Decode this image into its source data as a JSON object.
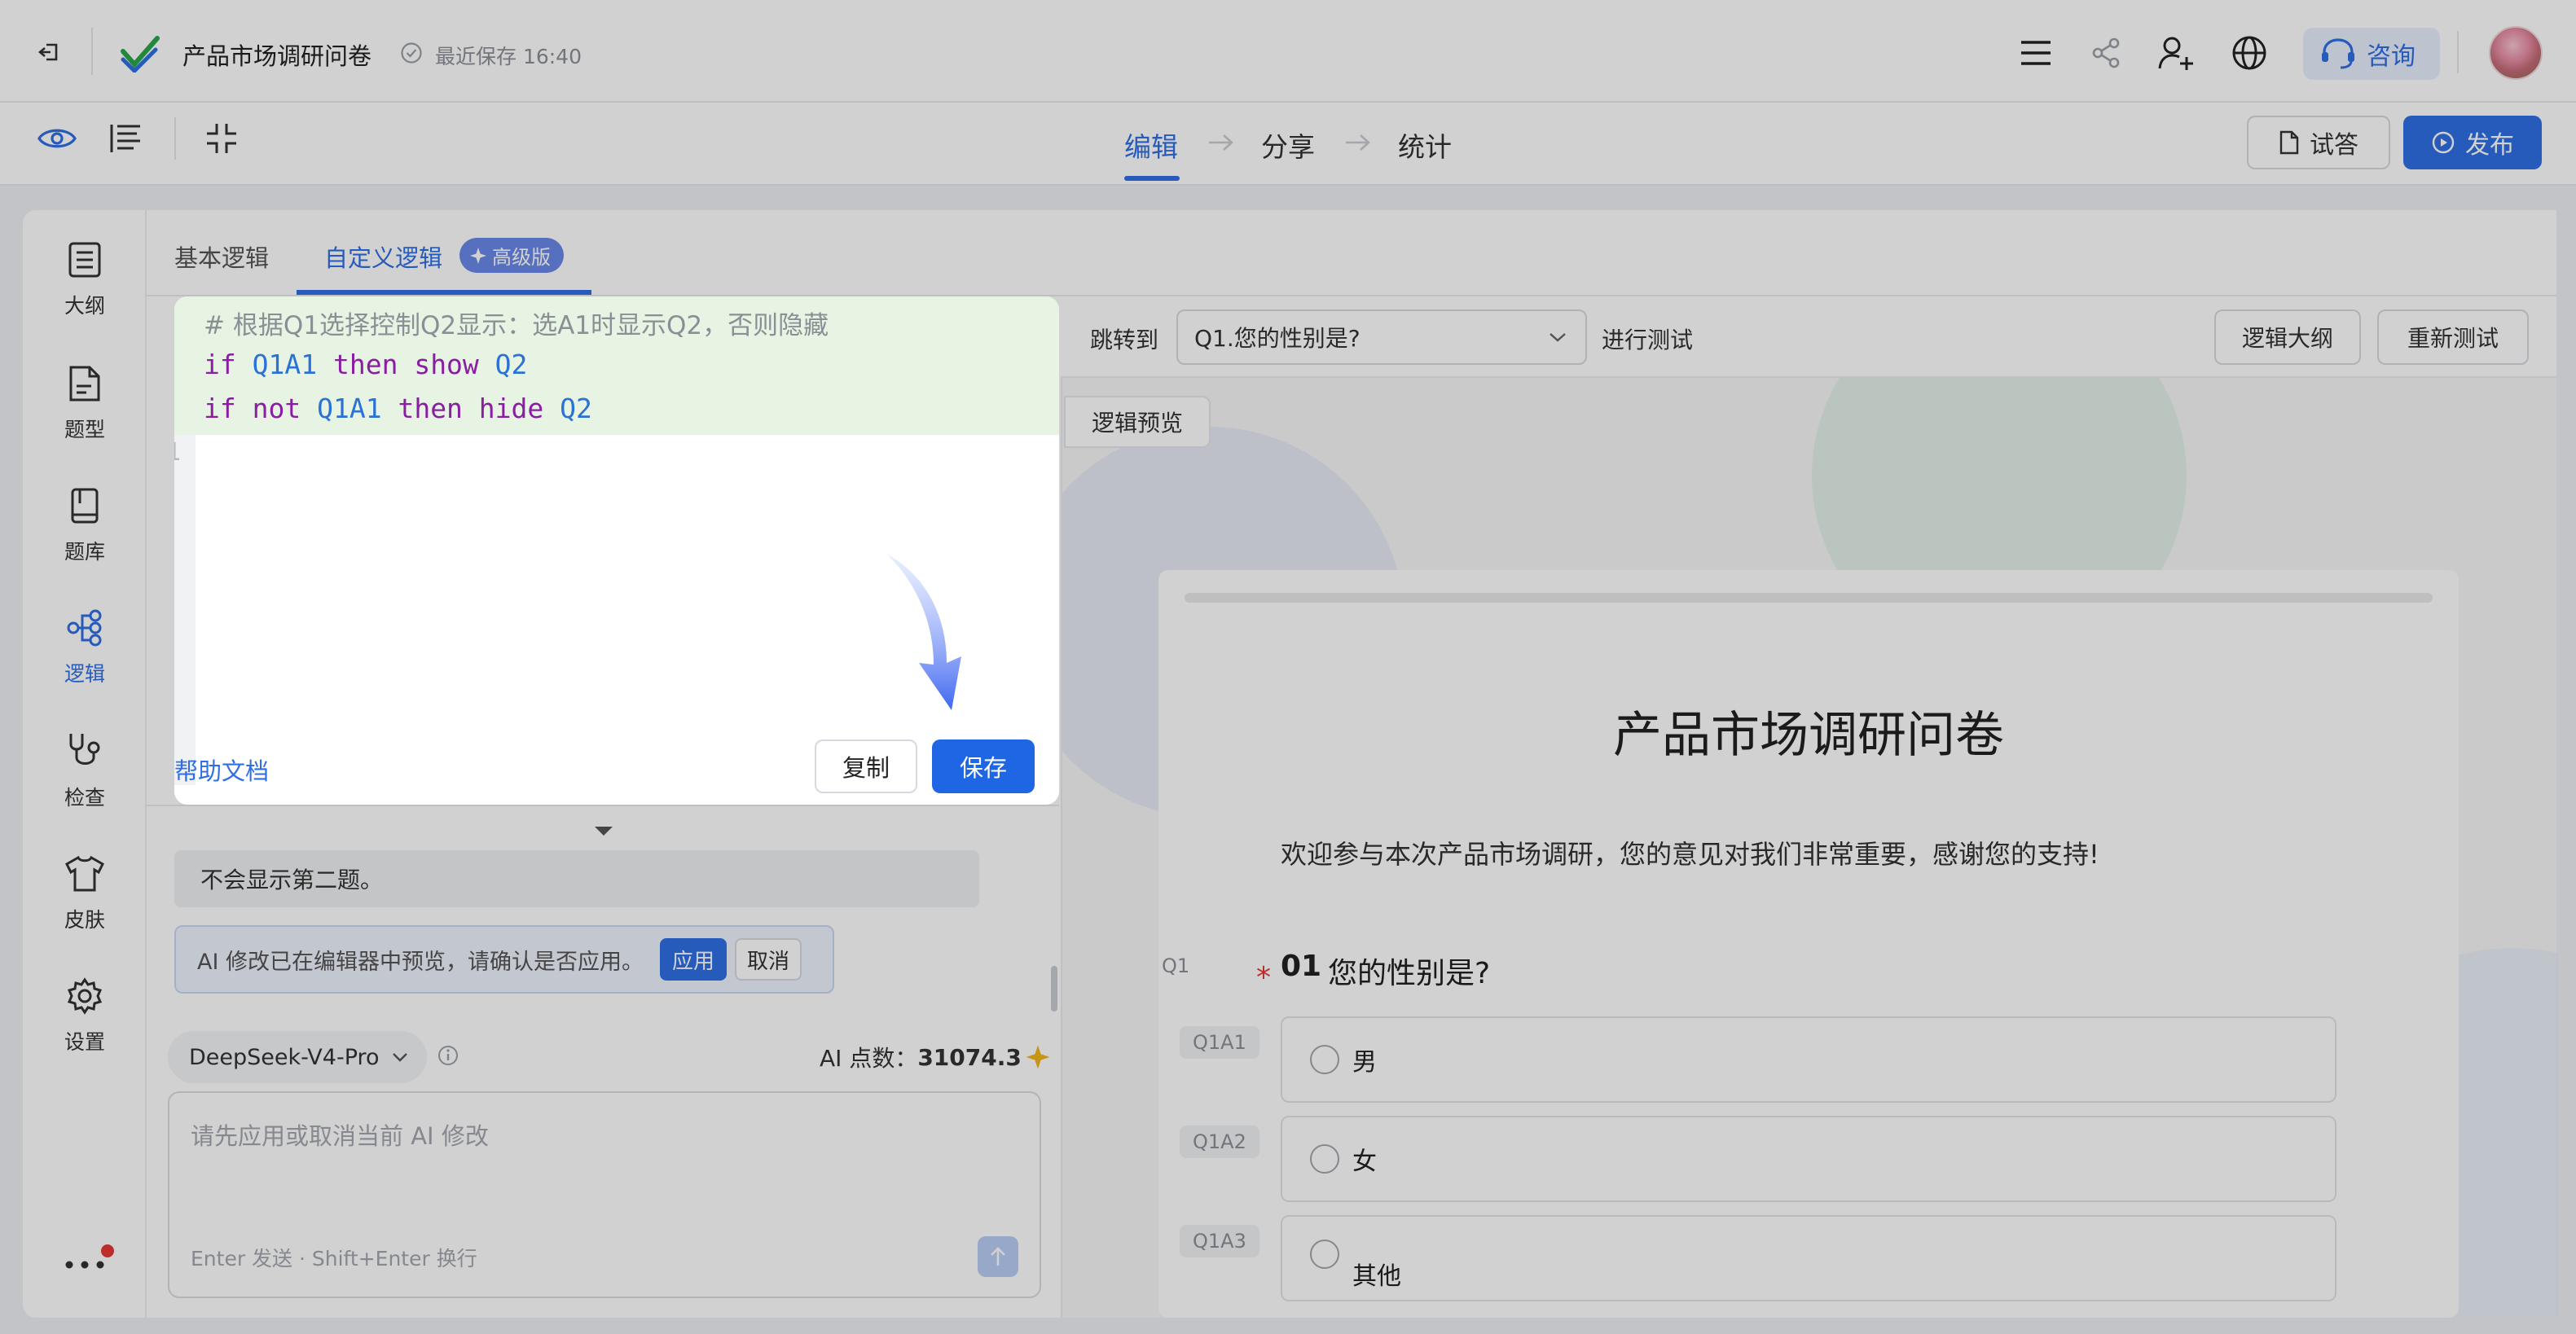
{
  "colors": {
    "accent": "#2f6fe4",
    "pro_badge": "#6a88e8",
    "code_keyword": "#8a1ea3",
    "code_identifier": "#2b72d6",
    "code_comment": "#8a8f96",
    "highlight": "#e7f3e3",
    "required": "#e53935"
  },
  "header": {
    "exit_icon": "exit-icon",
    "app_logo": "check-logo-icon",
    "doc_title": "产品市场调研问卷",
    "save_status": "最近保存 16:40",
    "consult_label": "咨询"
  },
  "navbar": {
    "steps": [
      {
        "label": "编辑",
        "active": true
      },
      {
        "label": "分享",
        "active": false
      },
      {
        "label": "统计",
        "active": false
      }
    ],
    "trial_label": "试答",
    "publish_label": "发布"
  },
  "sidebar": {
    "items": [
      {
        "label": "大纲",
        "icon": "outline-icon"
      },
      {
        "label": "题型",
        "icon": "question-type-icon"
      },
      {
        "label": "题库",
        "icon": "question-bank-icon"
      },
      {
        "label": "逻辑",
        "icon": "logic-icon",
        "active": true
      },
      {
        "label": "检查",
        "icon": "stethoscope-icon"
      },
      {
        "label": "皮肤",
        "icon": "shirt-icon"
      },
      {
        "label": "设置",
        "icon": "gear-icon"
      }
    ]
  },
  "logic_tabs": {
    "basic": "基本逻辑",
    "custom": "自定义逻辑",
    "pro_badge": "高级版"
  },
  "editor": {
    "comment_line": "# 根据Q1选择控制Q2显示：选A1时显示Q2，否则隐藏",
    "line1": {
      "kw1": "if",
      "id1": "Q1A1",
      "kw2": "then show",
      "id2": "Q2"
    },
    "line2": {
      "kw1": "if not",
      "id1": "Q1A1",
      "kw2": "then hide",
      "id2": "Q2"
    },
    "line_number": "1",
    "help_link": "帮助文档",
    "copy_label": "复制",
    "save_label": "保存"
  },
  "chat": {
    "message": "不会显示第二题。",
    "notice": "AI 修改已在编辑器中预览，请确认是否应用。",
    "apply_label": "应用",
    "cancel_label": "取消",
    "model": "DeepSeek-V4-Pro",
    "points_label": "AI 点数：",
    "points_value": "31074.3",
    "input_placeholder": "请先应用或取消当前 AI 修改",
    "hint": "Enter 发送 · Shift+Enter 换行"
  },
  "preview_toolbar": {
    "jump_label": "跳转到",
    "jump_value": "Q1.您的性别是?",
    "test_label": "进行测试",
    "outline_btn": "逻辑大纲",
    "retest_btn": "重新测试",
    "preview_tab": "逻辑预览"
  },
  "survey": {
    "title": "产品市场调研问卷",
    "intro": "欢迎参与本次产品市场调研，您的意见对我们非常重要，感谢您的支持!",
    "q1": {
      "tag": "Q1",
      "required_mark": "*",
      "number": "01",
      "text": "您的性别是?",
      "options": [
        {
          "tag": "Q1A1",
          "label": "男"
        },
        {
          "tag": "Q1A2",
          "label": "女"
        },
        {
          "tag": "Q1A3",
          "label": "其他"
        }
      ]
    }
  }
}
